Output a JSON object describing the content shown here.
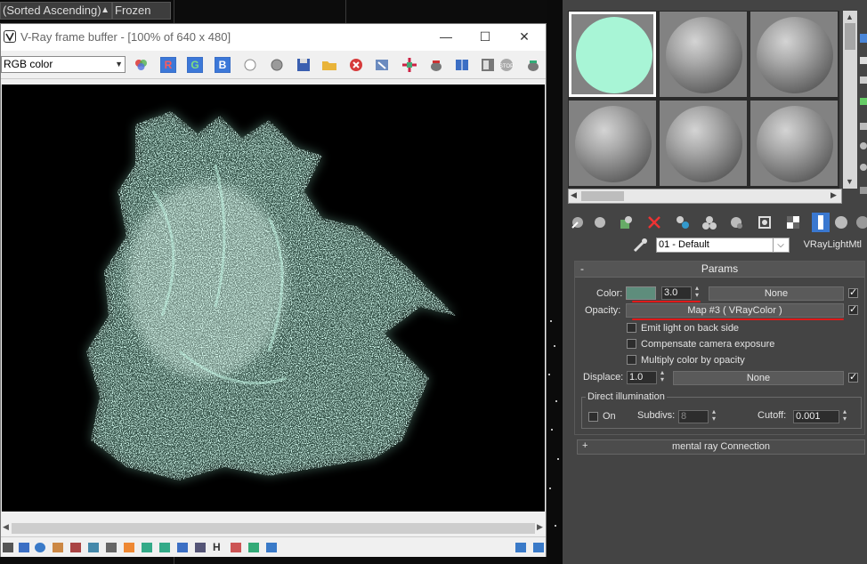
{
  "colors": {
    "mint": "#a8f5d6",
    "vray_swatch": "#5e8d7c",
    "annotation_red": "#e01a1a"
  },
  "viewport_header": {
    "sort_label": "(Sorted Ascending)",
    "arrow": "▲",
    "frozen_label": "Frozen"
  },
  "vfb": {
    "title": "V-Ray frame buffer - [100% of 640 x 480]",
    "minimize": "—",
    "maximize": "☐",
    "close": "✕",
    "channel": "RGB color",
    "r_label": "R",
    "g_label": "G",
    "b_label": "B"
  },
  "material_editor": {
    "material_name": "01 - Default",
    "material_type": "VRayLightMtl",
    "params_rollout": {
      "collapse_sign": "-",
      "title": "Params",
      "color_label": "Color:",
      "color_multiplier": "3.0",
      "color_map": "None",
      "opacity_label": "Opacity:",
      "opacity_map": "Map #3  ( VRayColor )",
      "emit_back_side": "Emit light on back side",
      "compensate_exposure": "Compensate camera exposure",
      "multiply_opacity": "Multiply color by opacity",
      "displace_label": "Displace:",
      "displace_value": "1.0",
      "displace_map": "None",
      "direct_illumination": "Direct illumination",
      "on_label": "On",
      "subdivs_label": "Subdivs:",
      "subdivs_value": "8",
      "cutoff_label": "Cutoff:",
      "cutoff_value": "0.001"
    },
    "mental_ray": {
      "expand_sign": "+",
      "title": "mental ray Connection"
    }
  }
}
